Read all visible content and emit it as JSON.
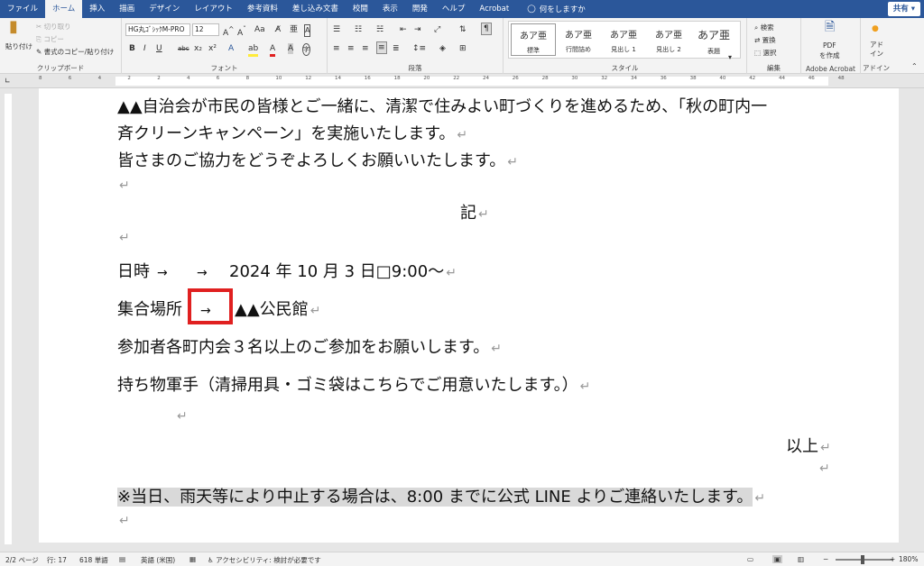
{
  "tabs": [
    "ファイル",
    "ホーム",
    "挿入",
    "描画",
    "デザイン",
    "レイアウト",
    "参考資料",
    "差し込み文書",
    "校閲",
    "表示",
    "開発",
    "ヘルプ",
    "Acrobat"
  ],
  "tell_me": "何をしますか",
  "share_label": "共有",
  "ribbon": {
    "clipboard": {
      "paste": "貼り付け",
      "cut": "切り取り",
      "copy": "コピー",
      "format_painter": "書式のコピー/貼り付け",
      "label": "クリップボード"
    },
    "font": {
      "name": "HG丸ｺﾞｼｯｸM-PRO",
      "size": "12",
      "aa": "Aa",
      "label": "フォント"
    },
    "paragraph": {
      "label": "段落"
    },
    "styles": {
      "items": [
        {
          "sample": "あア亜",
          "name": "標準"
        },
        {
          "sample": "あア亜",
          "name": "行間詰め"
        },
        {
          "sample": "あア亜",
          "name": "見出し 1"
        },
        {
          "sample": "あア亜",
          "name": "見出し 2"
        },
        {
          "sample": "あア亜",
          "name": "表題"
        }
      ],
      "label": "スタイル"
    },
    "editing": {
      "find": "検索",
      "replace": "置換",
      "select": "選択",
      "label": "編集"
    },
    "adobe": {
      "pdf": "PDF",
      "create": "を作成",
      "label": "Adobe Acrobat"
    },
    "addins": {
      "line1": "アド",
      "line2": "イン",
      "label": "アドイン"
    }
  },
  "ruler_ticks": [
    "8",
    "6",
    "4",
    "2",
    "2",
    "4",
    "6",
    "8",
    "10",
    "12",
    "14",
    "16",
    "18",
    "20",
    "22",
    "24",
    "26",
    "28",
    "30",
    "32",
    "34",
    "36",
    "38",
    "40",
    "42",
    "44",
    "46",
    "48"
  ],
  "doc": {
    "line1": "▲▲自治会が市民の皆様とご一緒に、清潔で住みよい町づくりを進めるため、「秋の町内一",
    "line2": "斉クリーンキャンペーン」を実施いたします。",
    "line3": "皆さまのご協力をどうぞよろしくお願いいたします。",
    "ki": "記",
    "date_label": "日時",
    "date_value": "2024 年 10 月 3 日□9:00～",
    "place_label": "集合場所",
    "place_value": "▲▲公民館",
    "participants": "参加者各町内会３名以上のご参加をお願いします。",
    "belongings": "持ち物軍手（清掃用具・ゴミ袋はこちらでご用意いたします。）",
    "ijo": "以上",
    "note": "※当日、雨天等により中止する場合は、8:00 までに公式 LINE よりご連絡いたします。",
    "arrow": "→",
    "para_mark": "↵"
  },
  "status": {
    "page": "2/2 ページ",
    "line": "行: 17",
    "words": "618 単語",
    "lang": "英語 (米国)",
    "accessibility": "アクセシビリティ: 検討が必要です",
    "zoom": "180%"
  }
}
